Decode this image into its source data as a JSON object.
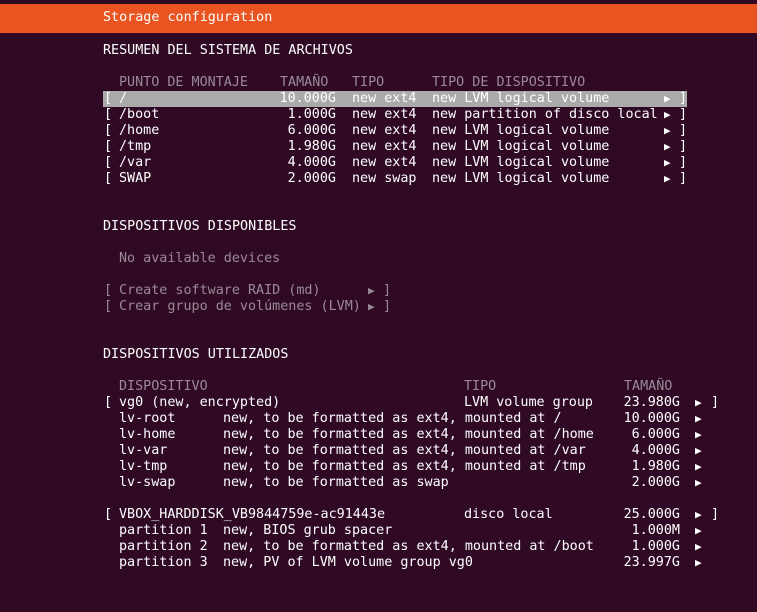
{
  "header": {
    "title": "Storage configuration"
  },
  "fs_summary": {
    "heading": "RESUMEN DEL SISTEMA DE ARCHIVOS",
    "columns": [
      "PUNTO DE MONTAJE",
      "TAMAÑO",
      "TIPO",
      "TIPO DE DISPOSITIVO"
    ],
    "rows": [
      {
        "bracket_l": "[",
        "mount": "/",
        "size": "10.000G",
        "type": "new ext4",
        "device": "new LVM logical volume",
        "arrow": "▶",
        "bracket_r": "]",
        "selected": true
      },
      {
        "bracket_l": "[",
        "mount": "/boot",
        "size": "1.000G",
        "type": "new ext4",
        "device": "new partition of disco local",
        "arrow": "▶",
        "bracket_r": "]"
      },
      {
        "bracket_l": "[",
        "mount": "/home",
        "size": "6.000G",
        "type": "new ext4",
        "device": "new LVM logical volume",
        "arrow": "▶",
        "bracket_r": "]"
      },
      {
        "bracket_l": "[",
        "mount": "/tmp",
        "size": "1.980G",
        "type": "new ext4",
        "device": "new LVM logical volume",
        "arrow": "▶",
        "bracket_r": "]"
      },
      {
        "bracket_l": "[",
        "mount": "/var",
        "size": "4.000G",
        "type": "new ext4",
        "device": "new LVM logical volume",
        "arrow": "▶",
        "bracket_r": "]"
      },
      {
        "bracket_l": "[",
        "mount": "SWAP",
        "size": "2.000G",
        "type": "new swap",
        "device": "new LVM logical volume",
        "arrow": "▶",
        "bracket_r": "]"
      }
    ]
  },
  "available": {
    "heading": "DISPOSITIVOS DISPONIBLES",
    "empty_text": "No available devices",
    "actions": [
      {
        "bracket_l": "[",
        "label": "Create software RAID (md)",
        "arrow": "▶",
        "bracket_r": "]"
      },
      {
        "bracket_l": "[",
        "label": "Crear grupo de volúmenes (LVM)",
        "arrow": "▶",
        "bracket_r": "]"
      }
    ]
  },
  "used": {
    "heading": "DISPOSITIVOS UTILIZADOS",
    "columns": [
      "DISPOSITIVO",
      "TIPO",
      "TAMAÑO"
    ],
    "groups": [
      {
        "bracket_l": "[",
        "name": "vg0 (new, encrypted)",
        "type": "LVM volume group",
        "size": "23.980G",
        "arrow": "▶",
        "bracket_r": "]",
        "children": [
          {
            "name": "lv-root",
            "desc": "new, to be formatted as ext4, mounted at /",
            "size": "10.000G",
            "arrow": "▶"
          },
          {
            "name": "lv-home",
            "desc": "new, to be formatted as ext4, mounted at /home",
            "size": "6.000G",
            "arrow": "▶"
          },
          {
            "name": "lv-var",
            "desc": "new, to be formatted as ext4, mounted at /var",
            "size": "4.000G",
            "arrow": "▶"
          },
          {
            "name": "lv-tmp",
            "desc": "new, to be formatted as ext4, mounted at /tmp",
            "size": "1.980G",
            "arrow": "▶"
          },
          {
            "name": "lv-swap",
            "desc": "new, to be formatted as swap",
            "size": "2.000G",
            "arrow": "▶"
          }
        ]
      },
      {
        "bracket_l": "[",
        "name": "VBOX_HARDDISK_VB9844759e-ac91443e",
        "type": "disco local",
        "size": "25.000G",
        "arrow": "▶",
        "bracket_r": "]",
        "children": [
          {
            "name": "partition 1",
            "desc": "new, BIOS grub spacer",
            "size": "1.000M",
            "arrow": "▶"
          },
          {
            "name": "partition 2",
            "desc": "new, to be formatted as ext4, mounted at /boot",
            "size": "1.000G",
            "arrow": "▶"
          },
          {
            "name": "partition 3",
            "desc": "new, PV of LVM volume group vg0",
            "size": "23.997G",
            "arrow": "▶"
          }
        ]
      }
    ]
  },
  "colors": {
    "header_bg": "#e95420",
    "background": "#300a24",
    "selection_bg": "#aaaaaa",
    "dim_text": "#9b8a96"
  }
}
